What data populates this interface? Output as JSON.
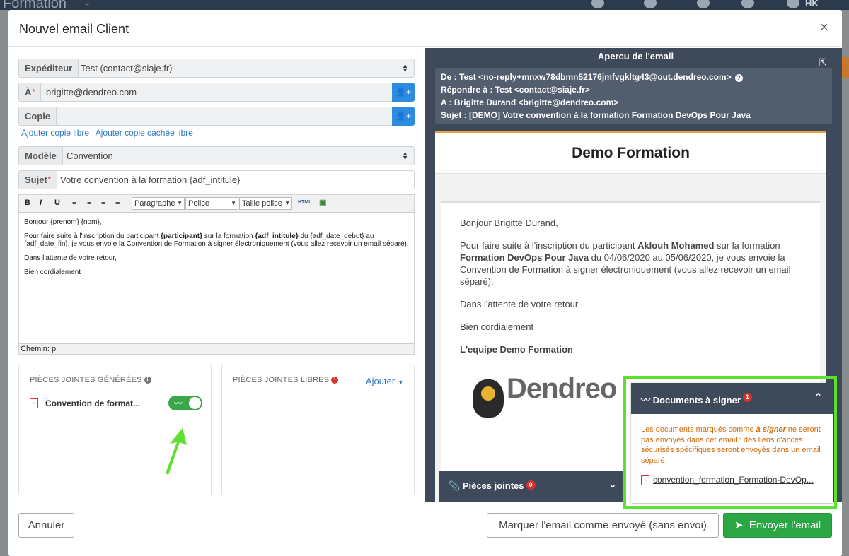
{
  "topbar": {
    "app_name": "Formation",
    "user_initials": "HK"
  },
  "modal": {
    "title": "Nouvel email Client",
    "close": "×"
  },
  "form": {
    "expediteur": {
      "label": "Expéditeur",
      "value": "Test (contact@siaje.fr)"
    },
    "to": {
      "label": "À",
      "required_mark": "*",
      "value": "brigitte@dendreo.com"
    },
    "copie": {
      "label": "Copie",
      "value": ""
    },
    "links": {
      "add_cc": "Ajouter copie libre",
      "add_bcc": "Ajouter copie cachée libre"
    },
    "modele": {
      "label": "Modèle",
      "value": "Convention"
    },
    "sujet": {
      "label": "Sujet",
      "required_mark": "*",
      "value": "Votre convention à la formation {adf_intitule}"
    }
  },
  "editor": {
    "toolbar": {
      "bold": "B",
      "italic": "I",
      "underline": "U",
      "format": "Paragraphe",
      "font": "Police",
      "size": "Taille police",
      "html": "HTML"
    },
    "greeting": "Bonjour {prenom} {nom},",
    "p1_a": "Pour faire suite à l'inscription du participant ",
    "p1_b": "{participant}",
    "p1_c": " sur la formation ",
    "p1_d": "{adf_intitule}",
    "p1_e": " du {adf_date_debut} au {adf_date_fin}, je vous envoie la Convention de Formation à signer électroniquement (vous allez recevoir un email séparé).",
    "p2": "Dans l'attente de votre retour,",
    "p3": "Bien cordialement",
    "path": "Chemin: p"
  },
  "attachments": {
    "generated_title": "PIÈCES JOINTES GÉNÉRÉES",
    "generated_item": "Convention de format...",
    "free_title": "PIÈCES JOINTES LIBRES",
    "add": "Ajouter"
  },
  "preview": {
    "title": "Apercu de l'email",
    "from": "De : Test <no-reply+mnxw78dbmn52176jmfvgkltg43@out.dendreo.com>",
    "reply_to": "Répondre à : Test <contact@siaje.fr>",
    "to": "A : Brigitte Durand <brigitte@dendreo.com>",
    "subject": "Sujet : [DEMO] Votre convention à la formation Formation DevOps Pour Java",
    "brand": "Demo Formation",
    "greeting": "Bonjour Brigitte Durand,",
    "p1_a": "Pour faire suite à l'inscription du participant ",
    "p1_b": "Aklouh Mohamed",
    "p1_c": " sur la formation ",
    "p1_d": "Formation DevOps Pour Java",
    "p1_e": " du 04/06/2020 au 05/06/2020, je vous envoie la Convention de Formation à signer électroniquement (vous allez recevoir un email séparé).",
    "p2": "Dans l'attente de votre retour,",
    "p3": "Bien cordialement",
    "signature": "L'equipe Demo Formation",
    "logo_text": "Dendreo",
    "attachments_panel": {
      "label": "Pièces jointes",
      "count": "0"
    }
  },
  "sign_panel": {
    "title": "Documents à signer",
    "count": "1",
    "text_a": "Les documents marqués comme ",
    "text_b": "à signer",
    "text_c": " ne seront pas envoyés dans cet email : des liens d'accès sécurisés spécifiques seront envoyés dans un email séparé.",
    "file": "convention_formation_Formation-DevOp..."
  },
  "footer": {
    "cancel": "Annuler",
    "mark_sent": "Marquer l'email comme envoyé (sans envoi)",
    "send": "Envoyer l'email"
  },
  "colors": {
    "primary": "#2d8ce0",
    "success": "#2aa744",
    "highlight": "#5de02f",
    "warning_text": "#d46b0a"
  }
}
